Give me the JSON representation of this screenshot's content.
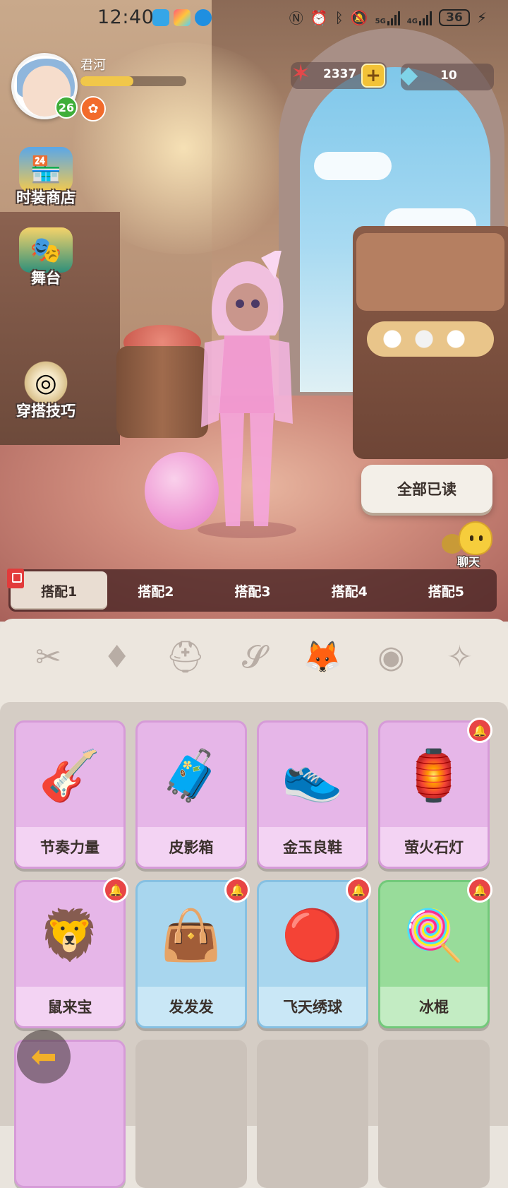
{
  "status_bar": {
    "time": "12:40",
    "network_primary": "5G",
    "network_secondary": "4G",
    "battery": "36"
  },
  "player": {
    "name": "君河",
    "level": "26",
    "xp_progress_percent": 50
  },
  "currencies": {
    "starfish": "2337",
    "gem": "10"
  },
  "side_menu": [
    {
      "label": "时装商店",
      "icon": "shop-icon"
    },
    {
      "label": "舞台",
      "icon": "stage-icon"
    },
    {
      "label": "穿搭技巧",
      "icon": "tips-icon"
    }
  ],
  "read_all_label": "全部已读",
  "chat_label": "聊天",
  "outfit_tabs": [
    "搭配1",
    "搭配2",
    "搭配3",
    "搭配4",
    "搭配5"
  ],
  "active_tab": "搭配1",
  "categories": [
    "hair-icon",
    "face-icon",
    "hat-icon",
    "handheld-icon",
    "pet-icon",
    "accessory-icon",
    "effect-icon"
  ],
  "items": [
    {
      "name": "节奏力量",
      "color": "pink",
      "icon": "guitar-icon",
      "new": false
    },
    {
      "name": "皮影箱",
      "color": "pink",
      "icon": "shadow-box-icon",
      "new": false
    },
    {
      "name": "金玉良鞋",
      "color": "pink",
      "icon": "sneaker-icon",
      "new": false
    },
    {
      "name": "萤火石灯",
      "color": "pink",
      "icon": "lantern-icon",
      "new": true
    },
    {
      "name": "鼠来宝",
      "color": "pink",
      "icon": "lion-dance-icon",
      "new": true
    },
    {
      "name": "发发发",
      "color": "blue",
      "icon": "mahjong-bag-icon",
      "new": true
    },
    {
      "name": "飞天绣球",
      "color": "blue",
      "icon": "fortune-ball-icon",
      "new": true
    },
    {
      "name": "冰棍",
      "color": "green",
      "icon": "popsicle-icon",
      "new": true
    }
  ],
  "colors": {
    "pink_card": "#e6b6e8",
    "blue_card": "#a8d6ee",
    "green_card": "#98dc9a",
    "notify_red": "#e84545",
    "xp_yellow": "#f1c74a"
  }
}
